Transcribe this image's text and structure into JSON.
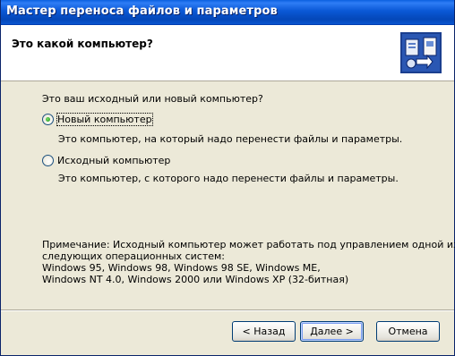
{
  "window": {
    "title": "Мастер переноса файлов и параметров"
  },
  "header": {
    "title": "Это какой компьютер?",
    "icon": "files-transfer-wizard-icon"
  },
  "content": {
    "question": "Это ваш исходный или новый компьютер?",
    "options": [
      {
        "label": "Новый компьютер",
        "description": "Это компьютер, на который надо перенести файлы и параметры.",
        "selected": true
      },
      {
        "label": "Исходный компьютер",
        "description": "Это компьютер, с которого надо перенести файлы и параметры.",
        "selected": false
      }
    ],
    "note_lines": [
      "Примечание: Исходный компьютер может работать под управлением одной из",
      "следующих операционных систем:",
      "Windows 95, Windows 98, Windows 98 SE, Windows ME,",
      "Windows NT 4.0, Windows 2000 или Windows XP (32-битная)"
    ]
  },
  "buttons": {
    "back": "< Назад",
    "next": "Далее >",
    "cancel": "Отмена"
  },
  "colors": {
    "title_bar": "#0a58d6",
    "dialog_bg": "#ece9d8",
    "radio_dot": "#21a121"
  }
}
